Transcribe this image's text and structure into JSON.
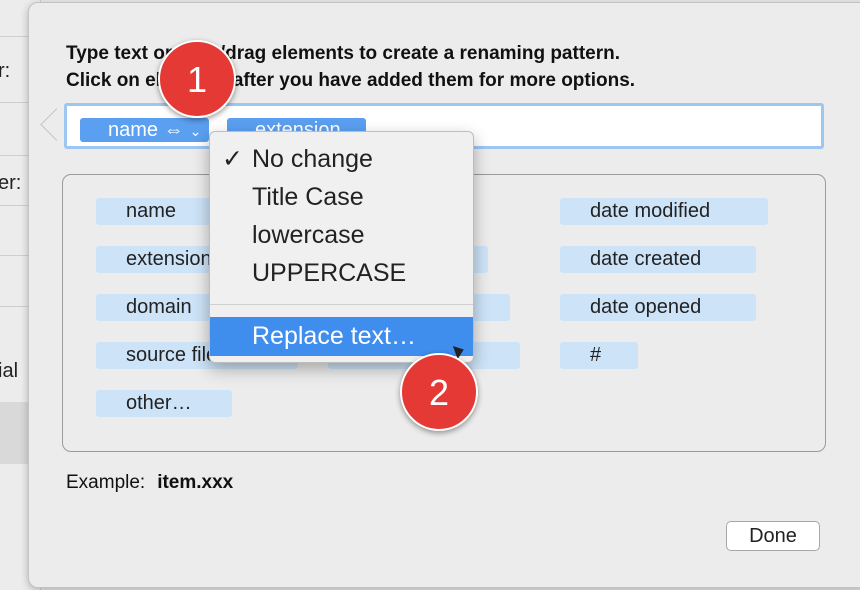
{
  "background": {
    "labels": [
      "r:",
      "er:",
      "ial"
    ]
  },
  "instructions": {
    "line1": "Type text or click/drag elements to create a renaming pattern.",
    "line2": "Click on elements after you have added them for more options."
  },
  "pattern_tokens": [
    {
      "label": "name ⇔",
      "chevron": "⌄"
    },
    {
      "label": "extension",
      "chevron": "⌄"
    }
  ],
  "elements": [
    "name",
    "extension",
    "domain",
    "source file",
    "other…",
    "date modified",
    "date created",
    "date opened",
    "#"
  ],
  "menu": {
    "items": [
      "No change",
      "Title Case",
      "lowercase",
      "UPPERCASE"
    ],
    "checked": "✓",
    "highlighted": "Replace text…"
  },
  "example": {
    "label": "Example:",
    "value": "item.xxx"
  },
  "done_label": "Done",
  "badges": [
    "1",
    "2"
  ],
  "colors": {
    "accent": "#3f8ded",
    "token": "#5b9ff0",
    "chip": "#cde3f8",
    "badge": "#e53935"
  }
}
